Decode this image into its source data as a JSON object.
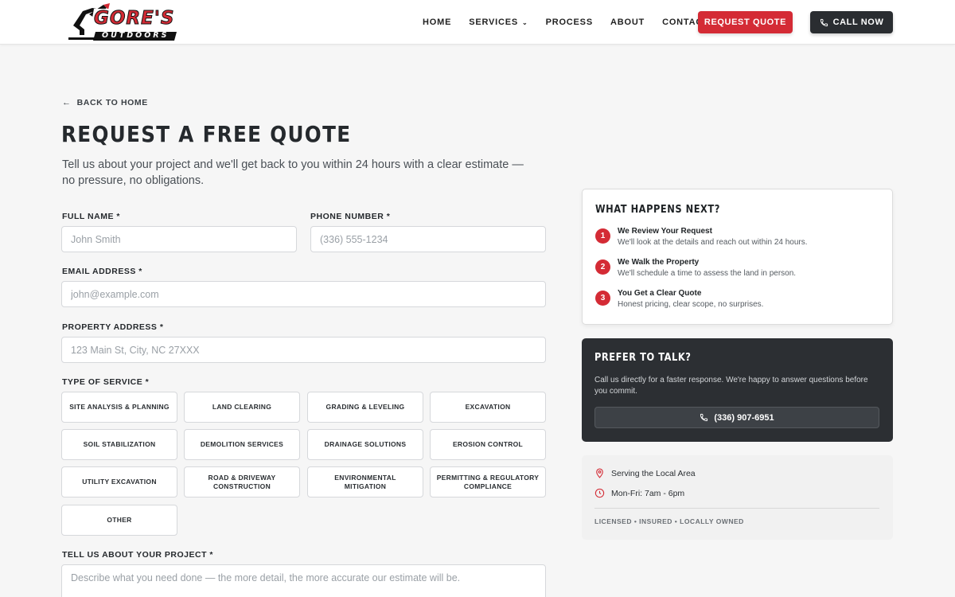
{
  "brand": {
    "logo_top": "GORE'S",
    "logo_bottom": "OUTDOORS"
  },
  "nav": {
    "items": [
      "HOME",
      "SERVICES",
      "PROCESS",
      "ABOUT",
      "CONTACT"
    ],
    "quote_label": "REQUEST QUOTE",
    "call_label": "CALL NOW"
  },
  "page": {
    "back_label": "BACK TO HOME",
    "title": "REQUEST A FREE QUOTE",
    "subtitle": "Tell us about your project and we'll get back to you within 24 hours with a clear estimate — no pressure, no obligations."
  },
  "form": {
    "full_name": {
      "label": "FULL NAME *",
      "placeholder": "John Smith"
    },
    "phone": {
      "label": "PHONE NUMBER *",
      "placeholder": "(336) 555-1234"
    },
    "email": {
      "label": "EMAIL ADDRESS *",
      "placeholder": "john@example.com"
    },
    "address": {
      "label": "PROPERTY ADDRESS *",
      "placeholder": "123 Main St, City, NC 27XXX"
    },
    "service_label": "TYPE OF SERVICE *",
    "services": [
      "SITE ANALYSIS & PLANNING",
      "LAND CLEARING",
      "GRADING & LEVELING",
      "EXCAVATION",
      "SOIL STABILIZATION",
      "DEMOLITION SERVICES",
      "DRAINAGE SOLUTIONS",
      "EROSION CONTROL",
      "UTILITY EXCAVATION",
      "ROAD & DRIVEWAY CONSTRUCTION",
      "ENVIRONMENTAL MITIGATION",
      "PERMITTING & REGULATORY COMPLIANCE",
      "OTHER"
    ],
    "project": {
      "label": "TELL US ABOUT YOUR PROJECT *",
      "placeholder": "Describe what you need done — the more detail, the more accurate our estimate will be."
    }
  },
  "next": {
    "title": "WHAT HAPPENS NEXT?",
    "steps": [
      {
        "num": "1",
        "head": "We Review Your Request",
        "desc": "We'll look at the details and reach out within 24 hours."
      },
      {
        "num": "2",
        "head": "We Walk the Property",
        "desc": "We'll schedule a time to assess the land in person."
      },
      {
        "num": "3",
        "head": "You Get a Clear Quote",
        "desc": "Honest pricing, clear scope, no surprises."
      }
    ]
  },
  "talk": {
    "title": "PREFER TO TALK?",
    "text": "Call us directly for a faster response. We're happy to answer questions before you commit.",
    "phone": "(336) 907-6951"
  },
  "info": {
    "area": "Serving the Local Area",
    "hours": "Mon-Fri: 7am - 6pm",
    "footer": "LICENSED • INSURED • LOCALLY OWNED"
  },
  "colors": {
    "accent": "#d42b35",
    "dark": "#2c2f33"
  }
}
